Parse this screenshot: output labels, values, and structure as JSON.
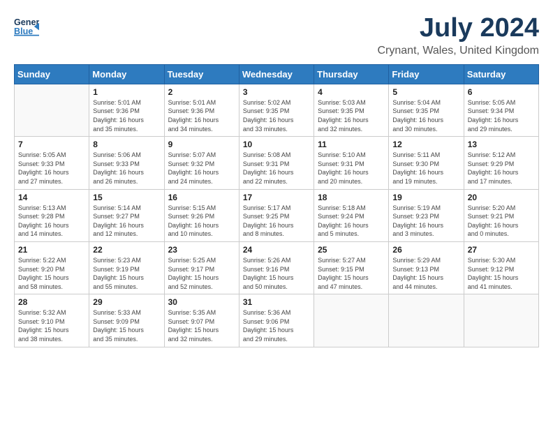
{
  "header": {
    "logo_general": "General",
    "logo_blue": "Blue",
    "month_year": "July 2024",
    "location": "Crynant, Wales, United Kingdom"
  },
  "calendar": {
    "days_of_week": [
      "Sunday",
      "Monday",
      "Tuesday",
      "Wednesday",
      "Thursday",
      "Friday",
      "Saturday"
    ],
    "weeks": [
      [
        {
          "day": "",
          "info": ""
        },
        {
          "day": "1",
          "info": "Sunrise: 5:01 AM\nSunset: 9:36 PM\nDaylight: 16 hours\nand 35 minutes."
        },
        {
          "day": "2",
          "info": "Sunrise: 5:01 AM\nSunset: 9:36 PM\nDaylight: 16 hours\nand 34 minutes."
        },
        {
          "day": "3",
          "info": "Sunrise: 5:02 AM\nSunset: 9:35 PM\nDaylight: 16 hours\nand 33 minutes."
        },
        {
          "day": "4",
          "info": "Sunrise: 5:03 AM\nSunset: 9:35 PM\nDaylight: 16 hours\nand 32 minutes."
        },
        {
          "day": "5",
          "info": "Sunrise: 5:04 AM\nSunset: 9:35 PM\nDaylight: 16 hours\nand 30 minutes."
        },
        {
          "day": "6",
          "info": "Sunrise: 5:05 AM\nSunset: 9:34 PM\nDaylight: 16 hours\nand 29 minutes."
        }
      ],
      [
        {
          "day": "7",
          "info": "Sunrise: 5:05 AM\nSunset: 9:33 PM\nDaylight: 16 hours\nand 27 minutes."
        },
        {
          "day": "8",
          "info": "Sunrise: 5:06 AM\nSunset: 9:33 PM\nDaylight: 16 hours\nand 26 minutes."
        },
        {
          "day": "9",
          "info": "Sunrise: 5:07 AM\nSunset: 9:32 PM\nDaylight: 16 hours\nand 24 minutes."
        },
        {
          "day": "10",
          "info": "Sunrise: 5:08 AM\nSunset: 9:31 PM\nDaylight: 16 hours\nand 22 minutes."
        },
        {
          "day": "11",
          "info": "Sunrise: 5:10 AM\nSunset: 9:31 PM\nDaylight: 16 hours\nand 20 minutes."
        },
        {
          "day": "12",
          "info": "Sunrise: 5:11 AM\nSunset: 9:30 PM\nDaylight: 16 hours\nand 19 minutes."
        },
        {
          "day": "13",
          "info": "Sunrise: 5:12 AM\nSunset: 9:29 PM\nDaylight: 16 hours\nand 17 minutes."
        }
      ],
      [
        {
          "day": "14",
          "info": "Sunrise: 5:13 AM\nSunset: 9:28 PM\nDaylight: 16 hours\nand 14 minutes."
        },
        {
          "day": "15",
          "info": "Sunrise: 5:14 AM\nSunset: 9:27 PM\nDaylight: 16 hours\nand 12 minutes."
        },
        {
          "day": "16",
          "info": "Sunrise: 5:15 AM\nSunset: 9:26 PM\nDaylight: 16 hours\nand 10 minutes."
        },
        {
          "day": "17",
          "info": "Sunrise: 5:17 AM\nSunset: 9:25 PM\nDaylight: 16 hours\nand 8 minutes."
        },
        {
          "day": "18",
          "info": "Sunrise: 5:18 AM\nSunset: 9:24 PM\nDaylight: 16 hours\nand 5 minutes."
        },
        {
          "day": "19",
          "info": "Sunrise: 5:19 AM\nSunset: 9:23 PM\nDaylight: 16 hours\nand 3 minutes."
        },
        {
          "day": "20",
          "info": "Sunrise: 5:20 AM\nSunset: 9:21 PM\nDaylight: 16 hours\nand 0 minutes."
        }
      ],
      [
        {
          "day": "21",
          "info": "Sunrise: 5:22 AM\nSunset: 9:20 PM\nDaylight: 15 hours\nand 58 minutes."
        },
        {
          "day": "22",
          "info": "Sunrise: 5:23 AM\nSunset: 9:19 PM\nDaylight: 15 hours\nand 55 minutes."
        },
        {
          "day": "23",
          "info": "Sunrise: 5:25 AM\nSunset: 9:17 PM\nDaylight: 15 hours\nand 52 minutes."
        },
        {
          "day": "24",
          "info": "Sunrise: 5:26 AM\nSunset: 9:16 PM\nDaylight: 15 hours\nand 50 minutes."
        },
        {
          "day": "25",
          "info": "Sunrise: 5:27 AM\nSunset: 9:15 PM\nDaylight: 15 hours\nand 47 minutes."
        },
        {
          "day": "26",
          "info": "Sunrise: 5:29 AM\nSunset: 9:13 PM\nDaylight: 15 hours\nand 44 minutes."
        },
        {
          "day": "27",
          "info": "Sunrise: 5:30 AM\nSunset: 9:12 PM\nDaylight: 15 hours\nand 41 minutes."
        }
      ],
      [
        {
          "day": "28",
          "info": "Sunrise: 5:32 AM\nSunset: 9:10 PM\nDaylight: 15 hours\nand 38 minutes."
        },
        {
          "day": "29",
          "info": "Sunrise: 5:33 AM\nSunset: 9:09 PM\nDaylight: 15 hours\nand 35 minutes."
        },
        {
          "day": "30",
          "info": "Sunrise: 5:35 AM\nSunset: 9:07 PM\nDaylight: 15 hours\nand 32 minutes."
        },
        {
          "day": "31",
          "info": "Sunrise: 5:36 AM\nSunset: 9:06 PM\nDaylight: 15 hours\nand 29 minutes."
        },
        {
          "day": "",
          "info": ""
        },
        {
          "day": "",
          "info": ""
        },
        {
          "day": "",
          "info": ""
        }
      ]
    ]
  }
}
